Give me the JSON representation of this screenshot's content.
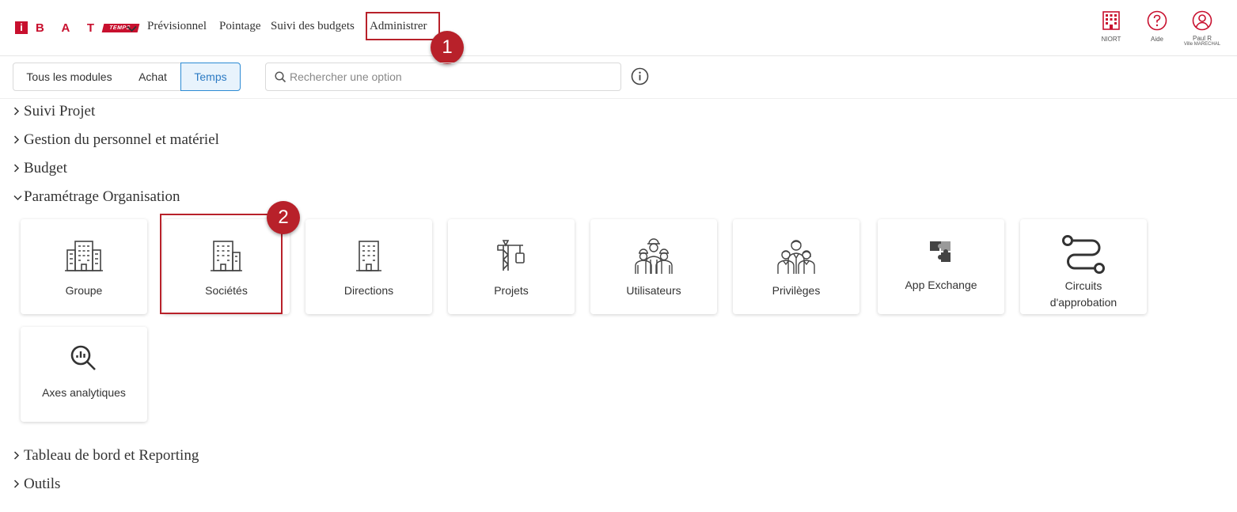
{
  "header": {
    "logo": {
      "letter": "i",
      "brand": "B A T",
      "product": "TEMPS"
    },
    "nav": [
      "Prévisionnel",
      "Pointage",
      "Suivi des budgets",
      "Administrer"
    ],
    "right": {
      "site_label": "NIORT",
      "help_label": "Aide",
      "user_name": "Paul R",
      "user_sub": "Ville MARECHAL"
    }
  },
  "callouts": [
    "1",
    "2"
  ],
  "filters": {
    "modules": [
      "Tous les modules",
      "Achat",
      "Temps"
    ],
    "active": "Temps",
    "search_placeholder": "Rechercher une option"
  },
  "sections": {
    "suivi_projet": "Suivi Projet",
    "gestion": "Gestion du personnel et matériel",
    "budget": "Budget",
    "parametrage": "Paramétrage Organisation",
    "tableau": "Tableau de bord et Reporting",
    "outils": "Outils"
  },
  "tiles": [
    {
      "label": "Groupe",
      "icon": "building-icon"
    },
    {
      "label": "Sociétés",
      "icon": "building-icon"
    },
    {
      "label": "Directions",
      "icon": "office-icon"
    },
    {
      "label": "Projets",
      "icon": "crane-icon"
    },
    {
      "label": "Utilisateurs",
      "icon": "workers-icon"
    },
    {
      "label": "Privilèges",
      "icon": "people-icon"
    },
    {
      "label": "App Exchange",
      "icon": "puzzle-icon"
    },
    {
      "label": "Circuits d'approbation",
      "icon": "workflow-icon"
    },
    {
      "label": "Axes analytiques",
      "icon": "analytics-icon"
    }
  ],
  "colors": {
    "brand": "#c8102e",
    "callout": "#b8212a",
    "active_tab": "#2d8bd4"
  }
}
